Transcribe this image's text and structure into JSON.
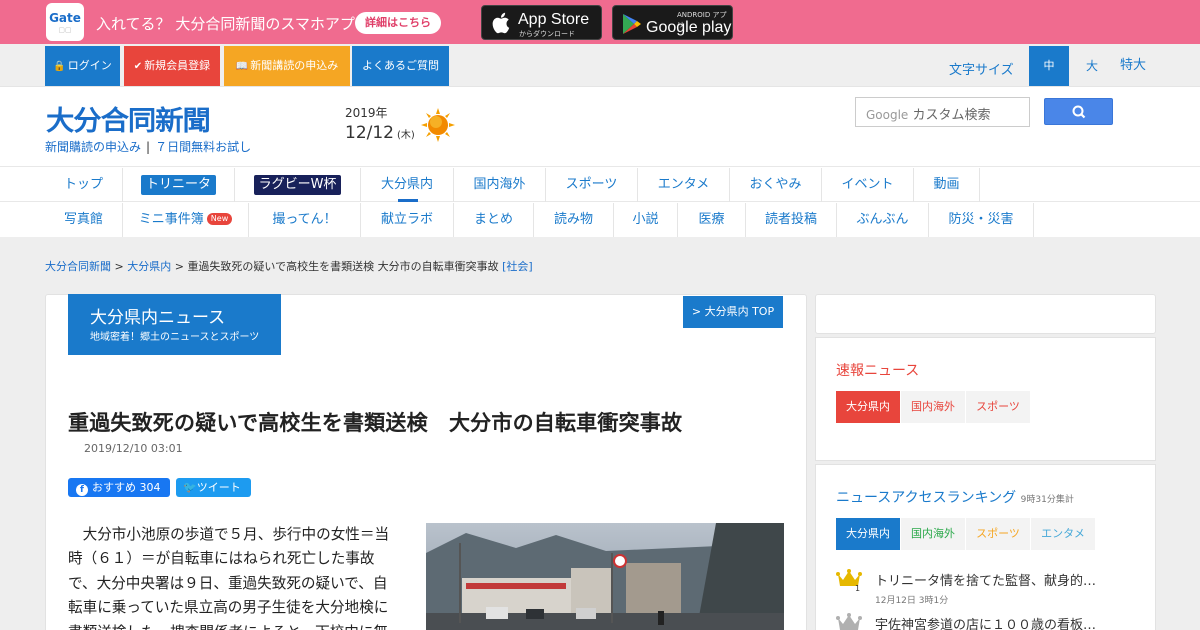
{
  "app_banner": {
    "logo": "Gate",
    "text": "入れてる？ 大分合同新聞のスマホアプリ",
    "button": "詳細はこちら",
    "appstore_small": "からダウンロード",
    "appstore_large": "App Store",
    "google_small": "ANDROID アプリ",
    "google_large": "Google play"
  },
  "util_bar": {
    "login": "ログイン",
    "register": "新規会員登録",
    "subscribe": "新聞講読の申込み",
    "faq": "よくあるご質問",
    "font_size_label": "文字サイズ",
    "font_sizes": [
      "中",
      "大",
      "特大"
    ]
  },
  "header": {
    "logo": "大分合同新聞",
    "link_subscribe": "新聞購読の申込み",
    "link_trial": "７日間無料お試し",
    "year": "2019年",
    "date": "12/12",
    "weekday": "(木)",
    "weather_icon": "sun-icon",
    "search_google": "Google",
    "search_placeholder": " カスタム検索"
  },
  "nav_primary": [
    "トップ",
    "トリニータ",
    "ラグビーW杯",
    "大分県内",
    "国内海外",
    "スポーツ",
    "エンタメ",
    "おくやみ",
    "イベント",
    "動画"
  ],
  "nav_secondary": [
    "写真館",
    "ミニ事件簿",
    "撮ってん！",
    "献立ラボ",
    "まとめ",
    "読み物",
    "小説",
    "医療",
    "読者投稿",
    "ぶんぶん",
    "防災・災害"
  ],
  "new_badge": "New",
  "breadcrumb": {
    "home": "大分合同新聞",
    "section": "大分県内",
    "current": "重過失致死の疑いで高校生を書類送検 大分市の自転車衝突事故",
    "category": "[社会]"
  },
  "section": {
    "title": "大分県内ニュース",
    "subtitle": "地域密着！郷土のニュースとスポーツ",
    "top_link": "> 大分県内 TOP"
  },
  "article": {
    "headline": "重過失致死の疑いで高校生を書類送検　大分市の自転車衝突事故",
    "timestamp": "2019/12/10 03:01",
    "fb_label": "おすすめ 304",
    "tw_label": "ツイート",
    "body": "　大分市小池原の歩道で５月、歩行中の女性＝当時（６１）＝が自転車にはねられ死亡した事故で、大分中央署は９日、重過失致死の疑いで、自転車に乗っていた県立高の男子生徒を大分地検に書類送検した。捜査関係者によると、下校中に無"
  },
  "sidebar": {
    "breaking_title": "速報ニュース",
    "breaking_tabs": [
      "大分県内",
      "国内海外",
      "スポーツ"
    ],
    "ranking_title": "ニュースアクセスランキング",
    "ranking_note": "9時31分集計",
    "ranking_tabs": [
      "大分県内",
      "国内海外",
      "スポーツ",
      "エンタメ"
    ],
    "ranking_items": [
      {
        "title": "トリニータ情を捨てた監督、献身的…",
        "time": "12月12日 3時1分"
      },
      {
        "title": "宇佐神宮参道の店に１００歳の看板…",
        "time": ""
      }
    ]
  },
  "colors": {
    "banner": "#f06b8f",
    "primary_blue": "#1a7acb",
    "navy": "#18215a",
    "red": "#e8453c",
    "orange": "#f5a623"
  }
}
